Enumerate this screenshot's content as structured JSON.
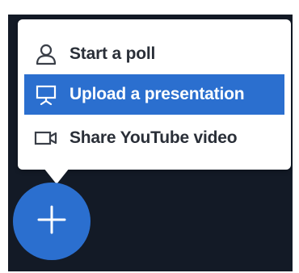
{
  "menu": {
    "items": [
      {
        "label": "Start a poll",
        "icon": "user-icon"
      },
      {
        "label": "Upload a presentation",
        "icon": "presentation-icon",
        "highlighted": true
      },
      {
        "label": "Share YouTube video",
        "icon": "video-camera-icon"
      }
    ]
  },
  "fab": {
    "icon": "plus-icon"
  },
  "colors": {
    "accent": "#2b6fcf",
    "background": "#131a26",
    "menu_text": "#2a2f38",
    "menu_bg": "#ffffff"
  }
}
